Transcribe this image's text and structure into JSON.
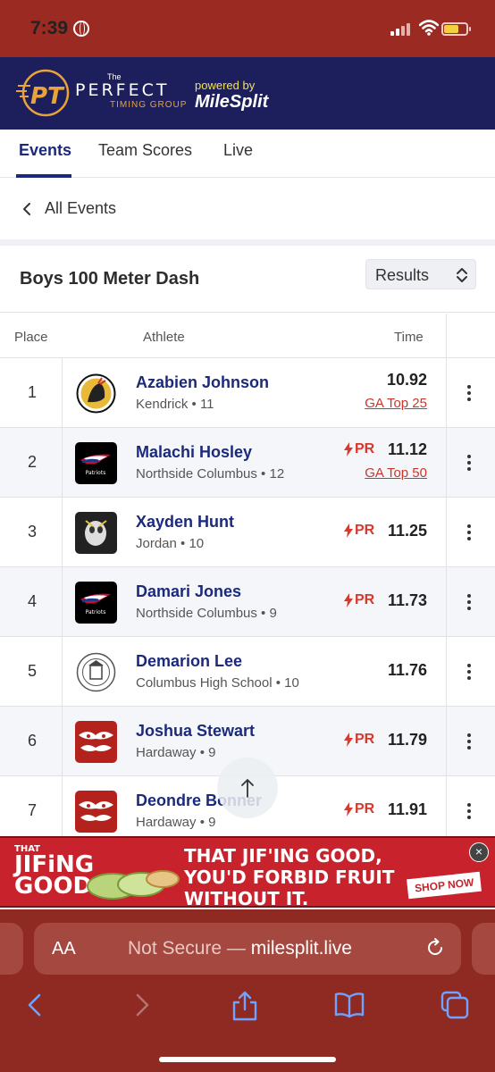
{
  "status_bar": {
    "time": "7:39"
  },
  "brand": {
    "logo_letters": "PT",
    "the": "The",
    "perfect": "PERFECT",
    "timing_group": "TIMING GROUP",
    "powered_by": "powered by",
    "milesplit": "MileSplit"
  },
  "tabs": [
    {
      "label": "Events",
      "active": true
    },
    {
      "label": "Team Scores",
      "active": false
    },
    {
      "label": "Live",
      "active": false
    }
  ],
  "back_label": "All Events",
  "event": {
    "title": "Boys 100 Meter Dash",
    "view_select": "Results"
  },
  "table": {
    "headers": {
      "place": "Place",
      "athlete": "Athlete",
      "time": "Time"
    },
    "pr_label": "PR",
    "rows": [
      {
        "place": "1",
        "name": "Azabien Johnson",
        "meta": "Kendrick • 11",
        "time": "10.92",
        "pr": false,
        "rank": "GA Top 25",
        "logo": "kendrick-cherokee-logo"
      },
      {
        "place": "2",
        "name": "Malachi Hosley",
        "meta": "Northside Columbus • 12",
        "time": "11.12",
        "pr": true,
        "rank": "GA Top 50",
        "logo": "patriots-logo"
      },
      {
        "place": "3",
        "name": "Xayden Hunt",
        "meta": "Jordan • 10",
        "time": "11.25",
        "pr": true,
        "rank": "",
        "logo": "jacket-logo"
      },
      {
        "place": "4",
        "name": "Damari Jones",
        "meta": "Northside Columbus • 9",
        "time": "11.73",
        "pr": true,
        "rank": "",
        "logo": "patriots-logo"
      },
      {
        "place": "5",
        "name": "Demarion Lee",
        "meta": "Columbus High School • 10",
        "time": "11.76",
        "pr": false,
        "rank": "",
        "logo": "columbus-seal-logo"
      },
      {
        "place": "6",
        "name": "Joshua Stewart",
        "meta": "Hardaway • 9",
        "time": "11.79",
        "pr": true,
        "rank": "",
        "logo": "hardaway-hawk-logo"
      },
      {
        "place": "7",
        "name": "Deondre Bonner",
        "meta": "Hardaway • 9",
        "time": "11.91",
        "pr": true,
        "rank": "",
        "logo": "hardaway-hawk-logo"
      }
    ]
  },
  "ad": {
    "brand_small": "THAT",
    "brand_line1": "JIFiNG",
    "brand_line2": "GOOD",
    "headline": "THAT JIF'ING GOOD, YOU'D FORBID FRUIT WITHOUT IT.",
    "cta": "SHOP NOW"
  },
  "browser": {
    "aa_label": "AA",
    "url_prefix": "Not Secure — ",
    "url_host": "milesplit.live"
  },
  "colors": {
    "navy": "#1b2a7a",
    "red": "#d63a2f",
    "banner": "#1d1f5c",
    "safari": "#8f2a22"
  }
}
